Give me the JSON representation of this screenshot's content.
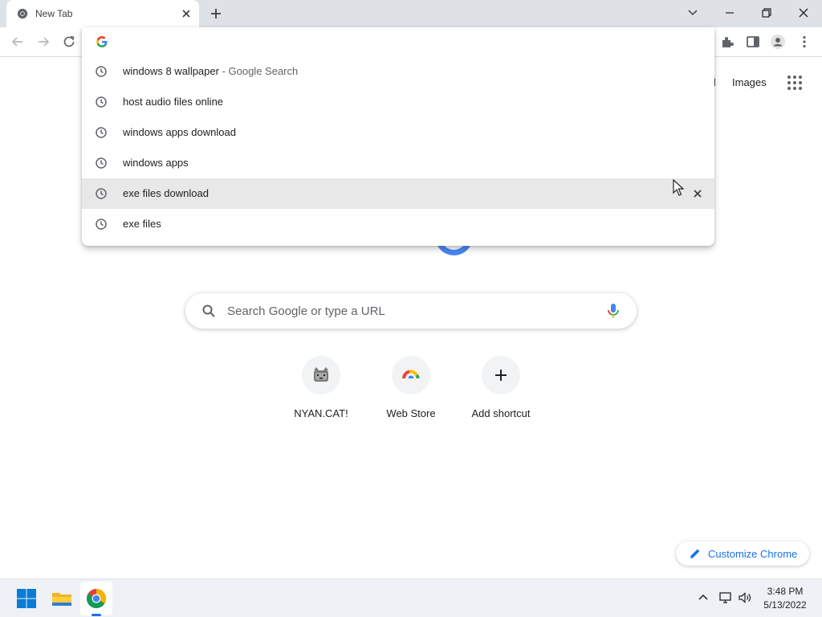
{
  "browser": {
    "tab": {
      "title": "New Tab"
    },
    "omnibox": {
      "value": ""
    },
    "suggestions": [
      {
        "text": "windows 8 wallpaper",
        "sub": " - Google Search",
        "highlighted": false
      },
      {
        "text": "host audio files online",
        "sub": "",
        "highlighted": false
      },
      {
        "text": "windows apps download",
        "sub": "",
        "highlighted": false
      },
      {
        "text": "windows apps",
        "sub": "",
        "highlighted": false
      },
      {
        "text": "exe files download",
        "sub": "",
        "highlighted": true
      },
      {
        "text": "exe files",
        "sub": "",
        "highlighted": false
      }
    ]
  },
  "page": {
    "header_links": {
      "gmail_fragment": "il",
      "images": "Images"
    },
    "search": {
      "placeholder": "Search Google or type a URL"
    },
    "shortcuts": [
      {
        "label": "NYAN.CAT!",
        "icon": "nyan-cat-icon"
      },
      {
        "label": "Web Store",
        "icon": "web-store-icon"
      },
      {
        "label": "Add shortcut",
        "icon": "plus-icon"
      }
    ],
    "customize_label": "Customize Chrome"
  },
  "taskbar": {
    "time": "3:48 PM",
    "date": "5/13/2022",
    "apps": [
      "start-icon",
      "file-explorer-icon",
      "chrome-icon"
    ]
  },
  "colors": {
    "accent": "#1a73e8",
    "tabstrip": "#dee1e6",
    "highlight": "#e8e8e9"
  }
}
